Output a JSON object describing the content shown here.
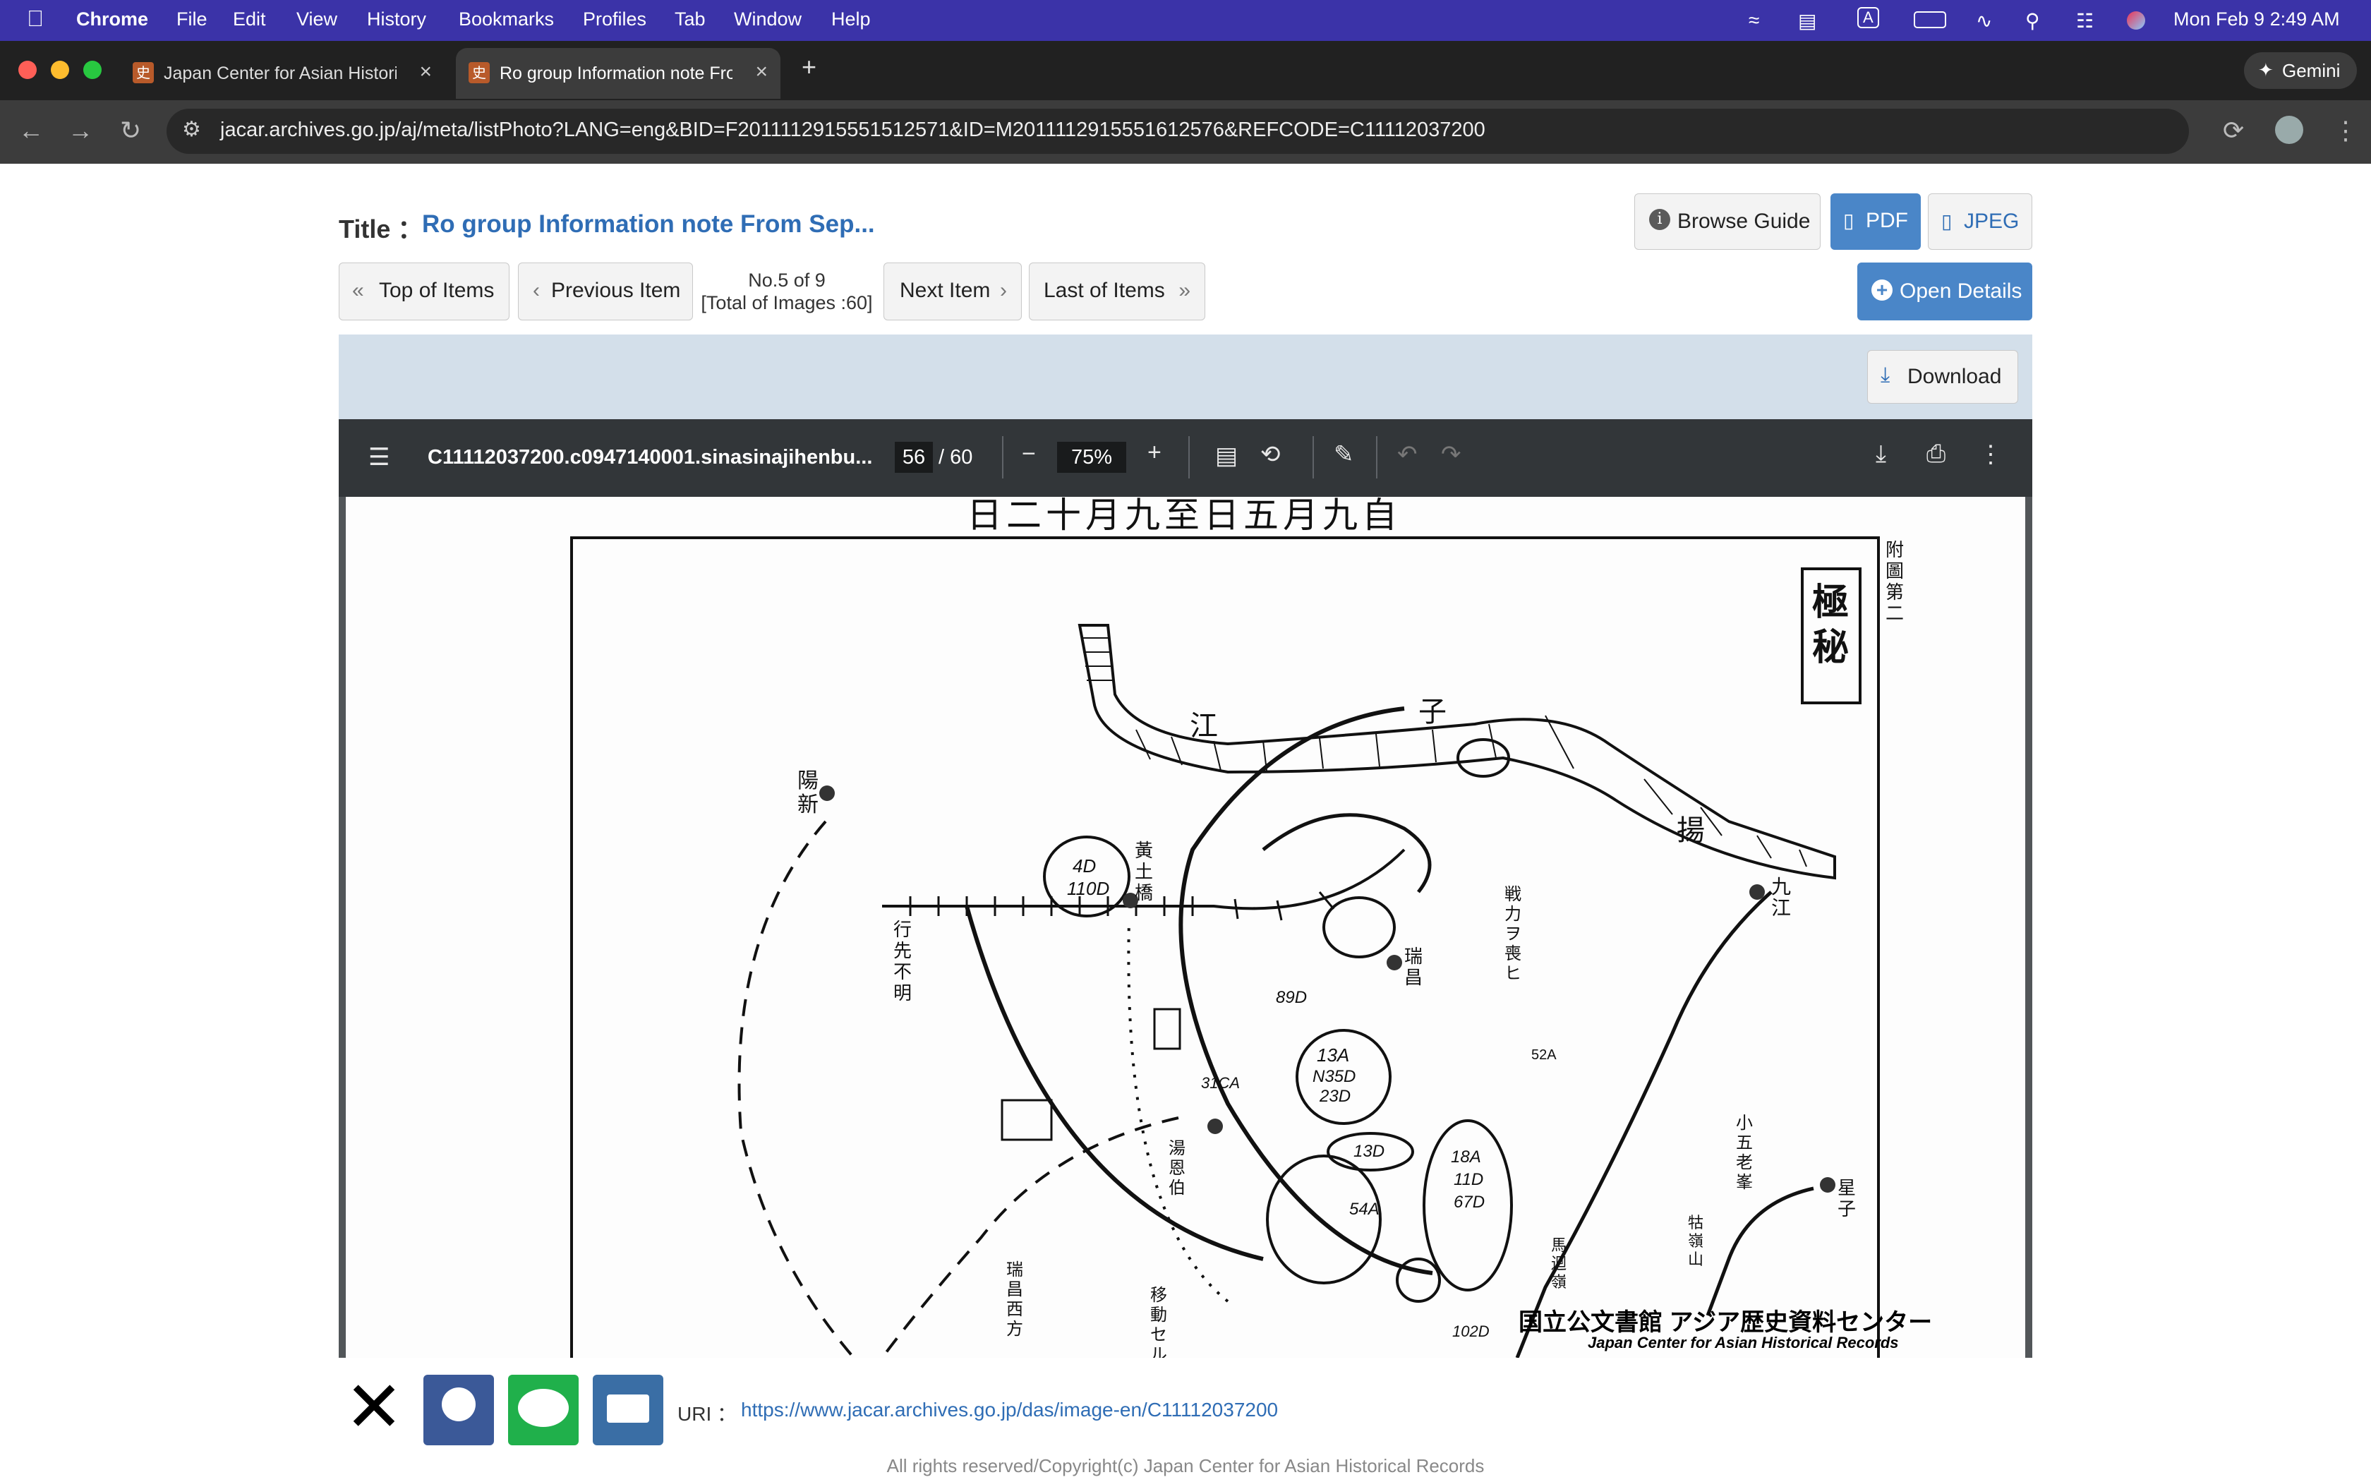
{
  "menubar": {
    "app": "Chrome",
    "items": [
      "File",
      "Edit",
      "View",
      "History",
      "Bookmarks",
      "Profiles",
      "Tab",
      "Window",
      "Help"
    ],
    "datetime": "Mon Feb 9  2:49 AM"
  },
  "tabs": [
    {
      "title": "Japan Center for Asian Histori",
      "favicon": "史"
    },
    {
      "title": "Ro group Information note Fro",
      "favicon": "史"
    }
  ],
  "gemini_label": "Gemini",
  "url": "jacar.archives.go.jp/aj/meta/listPhoto?LANG=eng&BID=F2011112915551512571&ID=M2011112915551612576&REFCODE=C11112037200",
  "page": {
    "title_label": "Title ：",
    "title_value": "Ro group Information note From Sep...",
    "browse_guide": "Browse Guide",
    "pdf": "PDF",
    "jpeg": "JPEG",
    "top_items": "Top of Items",
    "prev_item": "Previous Item",
    "item_no": "No.5 of 9",
    "total_images": "[Total of Images :60]",
    "next_item": "Next Item",
    "last_items": "Last of Items",
    "open_details": "Open Details",
    "download": "Download"
  },
  "viewer": {
    "filename": "C11112037200.c0947140001.sinasinajihenbu...",
    "page_current": "56",
    "page_total": "/ 60",
    "zoom": "75%"
  },
  "document": {
    "header_text": "日二十月九至日五月九自",
    "stamp": "極秘",
    "side_note": "附圖第二",
    "footer_stamp": "国立公文書館 アジア歴史資料センター",
    "footer_stamp_en": "Japan Center for Asian Historical Records",
    "map_labels": [
      "江",
      "子",
      "揚",
      "陽新",
      "九江",
      "瑞昌",
      "星子",
      "行先不明",
      "黃土橋",
      "戦力ヲ喪ヒ",
      "13A",
      "N35D",
      "23D",
      "13D",
      "4D",
      "110D",
      "52A",
      "89D",
      "18A",
      "11D",
      "67D",
      "102D",
      "54A",
      "31CA",
      "小五老峯",
      "牯嶺山",
      "馬迴嶺",
      "湯恩伯",
      "移動セル",
      "瑞昌西方"
    ]
  },
  "footer": {
    "uri_label": "URI ：",
    "uri": "https://www.jacar.archives.go.jp/das/image-en/C11112037200",
    "copyright": "All rights reserved/Copyright(c) Japan Center for Asian Historical Records"
  }
}
